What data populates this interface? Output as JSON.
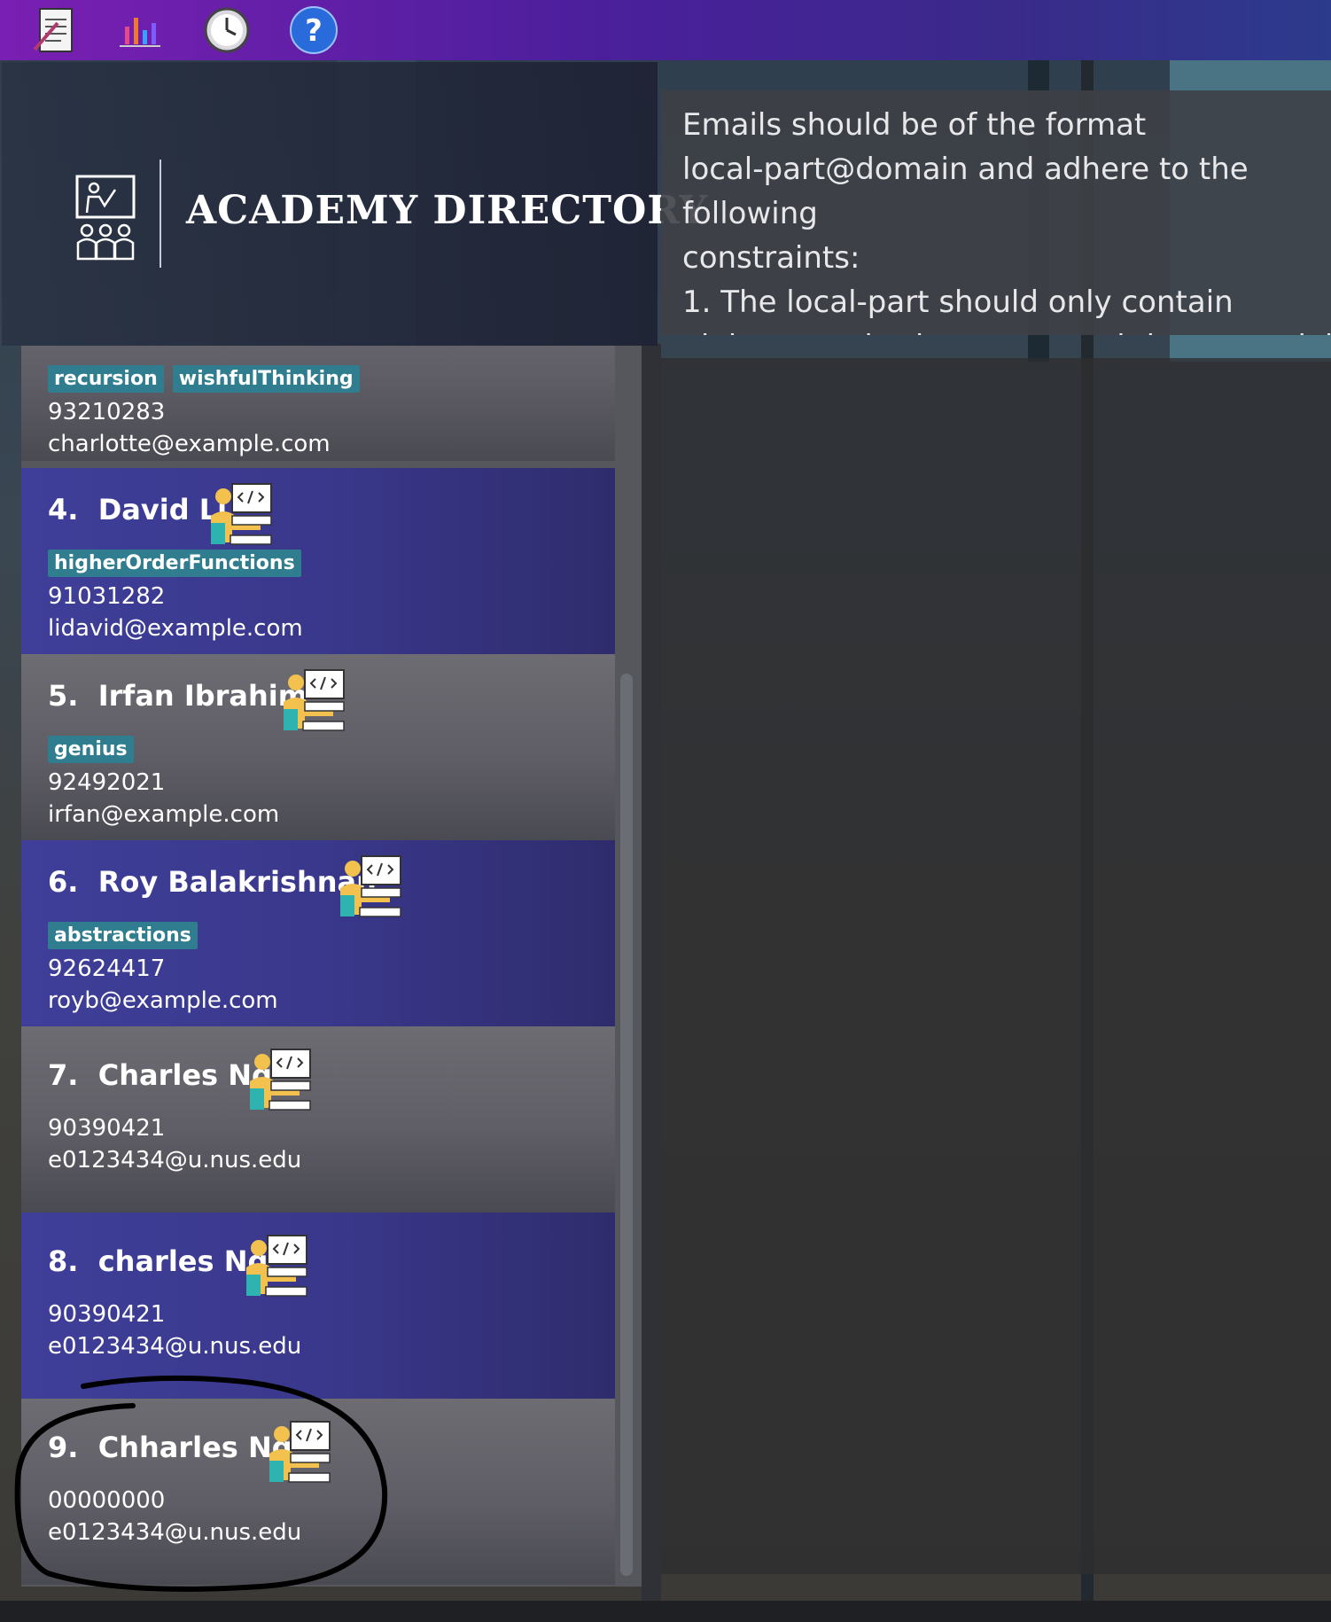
{
  "toolbar": {
    "buttons": [
      {
        "name": "notes-icon"
      },
      {
        "name": "bar-chart-icon"
      },
      {
        "name": "history-clock-icon"
      },
      {
        "name": "help-icon",
        "glyph": "?"
      }
    ]
  },
  "header": {
    "title": "ACADEMY DIRECTORY"
  },
  "result": {
    "text": "Emails should be of the format\nlocal-part@domain and adhere to the following\nconstraints:\n1. The local-part should only contain\nalphanumeric characters and these special"
  },
  "students": [
    {
      "index": "",
      "name": "",
      "tags": [
        "recursion",
        "wishfulThinking"
      ],
      "phone": "93210283",
      "email": "charlotte@example.com"
    },
    {
      "index": "4.",
      "name": "David Li",
      "tags": [
        "higherOrderFunctions"
      ],
      "phone": "91031282",
      "email": "lidavid@example.com"
    },
    {
      "index": "5.",
      "name": "Irfan Ibrahim",
      "tags": [
        "genius"
      ],
      "phone": "92492021",
      "email": "irfan@example.com"
    },
    {
      "index": "6.",
      "name": "Roy Balakrishnan",
      "tags": [
        "abstractions"
      ],
      "phone": "92624417",
      "email": "royb@example.com"
    },
    {
      "index": "7.",
      "name": "Charles Ng",
      "tags": [],
      "phone": "90390421",
      "email": "e0123434@u.nus.edu"
    },
    {
      "index": "8.",
      "name": "charles Ng",
      "tags": [],
      "phone": "90390421",
      "email": "e0123434@u.nus.edu"
    },
    {
      "index": "9.",
      "name": "Chharles Ng",
      "tags": [],
      "phone": "00000000",
      "email": "e0123434@u.nus.edu"
    }
  ],
  "colors": {
    "card_blue": "#3a388c",
    "card_grey": "#5f5e66",
    "tag": "#2f7d8e",
    "icon_yellow": "#f2c14e",
    "icon_teal": "#2fb3b0"
  }
}
